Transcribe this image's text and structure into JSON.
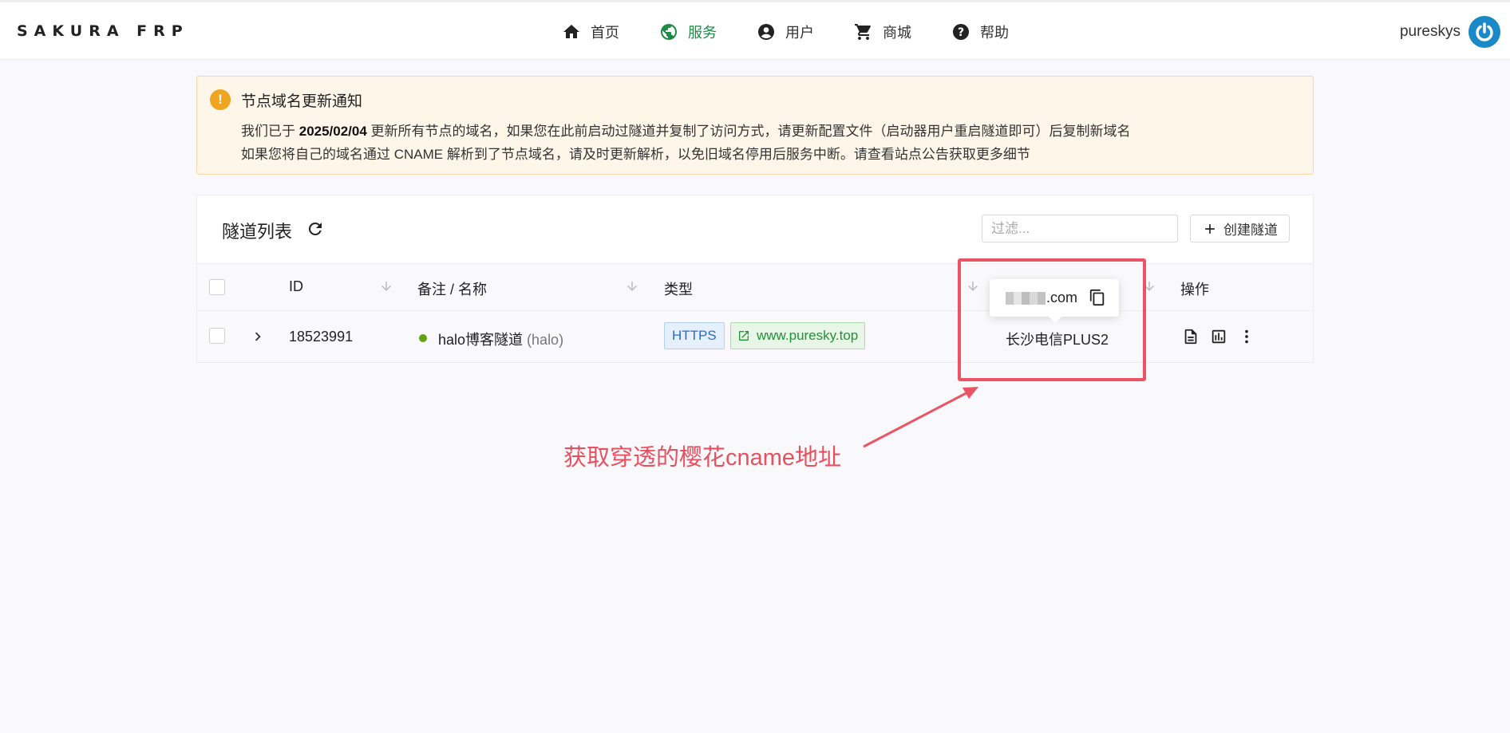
{
  "header": {
    "brand": "SAKURA FRP",
    "nav": [
      {
        "label": "首页",
        "icon": "home-icon"
      },
      {
        "label": "服务",
        "icon": "globe-icon",
        "active": true
      },
      {
        "label": "用户",
        "icon": "user-circle-icon"
      },
      {
        "label": "商城",
        "icon": "cart-icon"
      },
      {
        "label": "帮助",
        "icon": "help-icon"
      }
    ],
    "username": "pureskys",
    "accent_color": "#1d8a45"
  },
  "notice": {
    "title": "节点域名更新通知",
    "line1_before": "我们已于 ",
    "line1_date": "2025/02/04",
    "line1_after": " 更新所有节点的域名，如果您在此前启动过隧道并复制了访问方式，请更新配置文件（启动器用户重启隧道即可）后复制新域名",
    "line2": "如果您将自己的域名通过 CNAME 解析到了节点域名，请及时更新解析，以免旧域名停用后服务中断。请查看站点公告获取更多细节"
  },
  "tunnels": {
    "title": "隧道列表",
    "filter_placeholder": "过滤...",
    "create_label": "创建隧道",
    "columns": {
      "id": "ID",
      "name": "备注 / 名称",
      "type": "类型",
      "actions": "操作"
    },
    "rows": [
      {
        "id": "18523991",
        "name": "halo博客隧道",
        "alias": "(halo)",
        "type": "HTTPS",
        "domain": "www.puresky.top",
        "node": "长沙电信PLUS2",
        "status": "online"
      }
    ]
  },
  "tooltip": {
    "domain_suffix": ".com"
  },
  "annotation": {
    "text": "获取穿透的樱花cname地址",
    "color": "#e8505f"
  }
}
